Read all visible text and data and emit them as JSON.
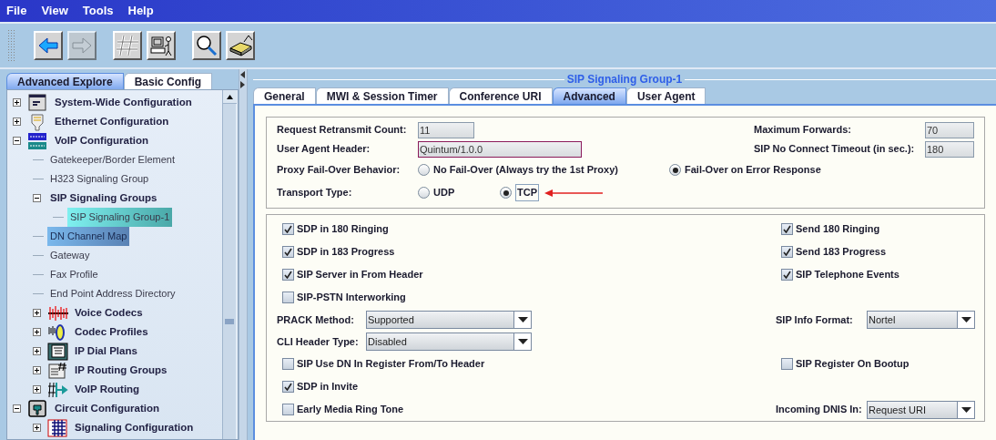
{
  "menu": [
    "File",
    "View",
    "Tools",
    "Help"
  ],
  "toolbar": [
    {
      "disabled": false
    },
    {
      "disabled": true
    },
    {
      "disabled": false
    },
    {
      "disabled": false
    },
    {
      "disabled": false
    },
    {
      "disabled": false
    }
  ],
  "explorer_tabs": [
    {
      "label": "Advanced Explore",
      "selected": true
    },
    {
      "label": "Basic Config",
      "selected": false
    }
  ],
  "tree": [
    {
      "kind": "category",
      "label": "System-Wide Configuration",
      "expanded": false,
      "selected": false,
      "highlighted": false
    },
    {
      "kind": "category",
      "label": "Ethernet Configuration",
      "expanded": false,
      "selected": false,
      "highlighted": false
    },
    {
      "kind": "category",
      "label": "VoIP Configuration",
      "expanded": true,
      "selected": false,
      "highlighted": false,
      "children": [
        {
          "kind": "page",
          "label": "Gatekeeper/Border Element",
          "selected": false,
          "highlighted": false
        },
        {
          "kind": "page",
          "label": "H323 Signaling Group",
          "selected": false,
          "highlighted": false
        },
        {
          "kind": "group",
          "label": "SIP Signaling Groups",
          "expanded": true,
          "selected": false,
          "highlighted": false,
          "children": [
            {
              "kind": "page",
              "label": "SIP Signaling Group-1",
              "selected": true,
              "highlighted": false
            }
          ]
        },
        {
          "kind": "page",
          "label": "DN Channel Map",
          "selected": false,
          "highlighted": true
        },
        {
          "kind": "page",
          "label": "Gateway",
          "selected": false,
          "highlighted": false
        },
        {
          "kind": "page",
          "label": "Fax Profile",
          "selected": false,
          "highlighted": false
        },
        {
          "kind": "page",
          "label": "End Point Address Directory",
          "selected": false,
          "highlighted": false
        },
        {
          "kind": "category",
          "label": "Voice Codecs",
          "expanded": false,
          "selected": false,
          "highlighted": false
        },
        {
          "kind": "category",
          "label": "Codec Profiles",
          "expanded": false,
          "selected": false,
          "highlighted": false
        },
        {
          "kind": "category",
          "label": "IP Dial Plans",
          "expanded": false,
          "selected": false,
          "highlighted": false
        },
        {
          "kind": "category",
          "label": "IP Routing Groups",
          "expanded": false,
          "selected": false,
          "highlighted": false
        },
        {
          "kind": "category",
          "label": "VoIP Routing",
          "expanded": false,
          "selected": false,
          "highlighted": false
        }
      ]
    },
    {
      "kind": "category",
      "label": "Circuit Configuration",
      "expanded": true,
      "selected": false,
      "highlighted": false,
      "children": [
        {
          "kind": "category",
          "label": "Signaling Configuration",
          "expanded": false,
          "selected": false,
          "highlighted": false
        }
      ]
    }
  ],
  "panel": {
    "title": "SIP Signaling Group-1",
    "tabs": [
      {
        "label": "General",
        "selected": false
      },
      {
        "label": "MWI & Session Timer",
        "selected": false
      },
      {
        "label": "Conference URI",
        "selected": false
      },
      {
        "label": "Advanced",
        "selected": true
      },
      {
        "label": "User Agent",
        "selected": false
      }
    ],
    "fields": [
      {
        "left": {
          "label": "Request Retransmit Count:",
          "value": "11"
        },
        "right": {
          "label": "Maximum Forwards:",
          "value": "70"
        }
      },
      {
        "left": {
          "label": "User Agent Header:",
          "value": "Quintum/1.0.0",
          "focused": true
        },
        "right": {
          "label": "SIP No Connect Timeout (in sec.):",
          "value": "180"
        }
      }
    ],
    "radio_groups": [
      {
        "label": "Proxy Fail-Over Behavior:",
        "options": [
          {
            "label": "No Fail-Over (Always try the 1st Proxy)",
            "selected": false
          },
          {
            "label": "Fail-Over on Error Response",
            "selected": true
          }
        ]
      },
      {
        "label": "Transport Type:",
        "options": [
          {
            "label": "UDP",
            "selected": false
          },
          {
            "label": "TCP",
            "selected": true
          }
        ],
        "annotated": true
      }
    ],
    "options": [
      {
        "left": {
          "kind": "checkbox",
          "label": "SDP in 180 Ringing",
          "checked": true
        },
        "right": {
          "kind": "checkbox",
          "label": "Send 180 Ringing",
          "checked": true
        }
      },
      {
        "left": {
          "kind": "checkbox",
          "label": "SDP in 183 Progress",
          "checked": true
        },
        "right": {
          "kind": "checkbox",
          "label": "Send 183 Progress",
          "checked": true
        }
      },
      {
        "left": {
          "kind": "checkbox",
          "label": "SIP Server in From Header",
          "checked": true
        },
        "right": {
          "kind": "checkbox",
          "label": "SIP Telephone Events",
          "checked": true
        }
      },
      {
        "left": {
          "kind": "checkbox",
          "label": "SIP-PSTN Interworking",
          "checked": false
        }
      },
      {
        "left": {
          "kind": "dropdown",
          "label": "PRACK Method:",
          "value": "Supported"
        },
        "right": {
          "kind": "dropdown",
          "label": "SIP Info Format:",
          "value": "Nortel"
        }
      },
      {
        "left": {
          "kind": "dropdown",
          "label": "CLI Header Type:",
          "value": "Disabled"
        }
      },
      {
        "left": {
          "kind": "checkbox",
          "label": "SIP Use DN In Register From/To Header",
          "checked": false
        },
        "right": {
          "kind": "checkbox",
          "label": "SIP Register On Bootup",
          "checked": false
        }
      },
      {
        "left": {
          "kind": "checkbox",
          "label": "SDP in Invite",
          "checked": true
        }
      },
      {
        "left": {
          "kind": "checkbox",
          "label": "Early Media Ring Tone",
          "checked": false
        },
        "right": {
          "kind": "dropdown",
          "label": "Incoming DNIS In:",
          "value": "Request URI"
        }
      }
    ]
  }
}
